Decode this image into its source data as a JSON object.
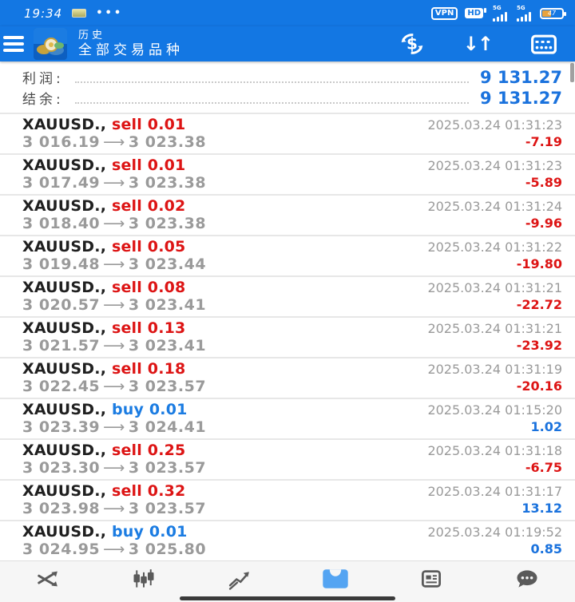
{
  "status_bar": {
    "time": "19:34",
    "menu_dots": "•••",
    "vpn_badge": "VPN",
    "hd_badge": "HD",
    "sim1_network": "5G",
    "sim2_network": "5G",
    "battery_percent": "47"
  },
  "header": {
    "title": "历史",
    "subtitle": "全部交易品种"
  },
  "summary": {
    "profit_label": "利润:",
    "profit_value": "9 131.27",
    "balance_label": "结余:",
    "balance_value": "9 131.27"
  },
  "trades": [
    {
      "symbol": "XAUUSD.,",
      "side": "sell",
      "volume": "0.01",
      "open": "3 016.19",
      "close": "3 023.38",
      "datetime": "2025.03.24 01:31:23",
      "profit": "-7.19"
    },
    {
      "symbol": "XAUUSD.,",
      "side": "sell",
      "volume": "0.01",
      "open": "3 017.49",
      "close": "3 023.38",
      "datetime": "2025.03.24 01:31:23",
      "profit": "-5.89"
    },
    {
      "symbol": "XAUUSD.,",
      "side": "sell",
      "volume": "0.02",
      "open": "3 018.40",
      "close": "3 023.38",
      "datetime": "2025.03.24 01:31:24",
      "profit": "-9.96"
    },
    {
      "symbol": "XAUUSD.,",
      "side": "sell",
      "volume": "0.05",
      "open": "3 019.48",
      "close": "3 023.44",
      "datetime": "2025.03.24 01:31:22",
      "profit": "-19.80"
    },
    {
      "symbol": "XAUUSD.,",
      "side": "sell",
      "volume": "0.08",
      "open": "3 020.57",
      "close": "3 023.41",
      "datetime": "2025.03.24 01:31:21",
      "profit": "-22.72"
    },
    {
      "symbol": "XAUUSD.,",
      "side": "sell",
      "volume": "0.13",
      "open": "3 021.57",
      "close": "3 023.41",
      "datetime": "2025.03.24 01:31:21",
      "profit": "-23.92"
    },
    {
      "symbol": "XAUUSD.,",
      "side": "sell",
      "volume": "0.18",
      "open": "3 022.45",
      "close": "3 023.57",
      "datetime": "2025.03.24 01:31:19",
      "profit": "-20.16"
    },
    {
      "symbol": "XAUUSD.,",
      "side": "buy",
      "volume": "0.01",
      "open": "3 023.39",
      "close": "3 024.41",
      "datetime": "2025.03.24 01:15:20",
      "profit": "1.02"
    },
    {
      "symbol": "XAUUSD.,",
      "side": "sell",
      "volume": "0.25",
      "open": "3 023.30",
      "close": "3 023.57",
      "datetime": "2025.03.24 01:31:18",
      "profit": "-6.75"
    },
    {
      "symbol": "XAUUSD.,",
      "side": "sell",
      "volume": "0.32",
      "open": "3 023.98",
      "close": "3 023.57",
      "datetime": "2025.03.24 01:31:17",
      "profit": "13.12"
    },
    {
      "symbol": "XAUUSD.,",
      "side": "buy",
      "volume": "0.01",
      "open": "3 024.95",
      "close": "3 025.80",
      "datetime": "2025.03.24 01:19:52",
      "profit": "0.85"
    }
  ],
  "icons": {
    "arrow": "⟶",
    "sort_down": "↓",
    "sort_up": "↑",
    "currency": "$"
  },
  "nav": {
    "items": [
      "quotes",
      "charts",
      "trade",
      "history",
      "news",
      "messages"
    ],
    "active": "history"
  },
  "colors": {
    "accent_blue": "#1377e3",
    "sell_red": "#dd1414",
    "buy_blue": "#1b7ce2",
    "profit_positive_blue": "#1a72dd",
    "nav_active_blue": "#54a4f2",
    "battery_fill_orange": "#e8a33d"
  }
}
